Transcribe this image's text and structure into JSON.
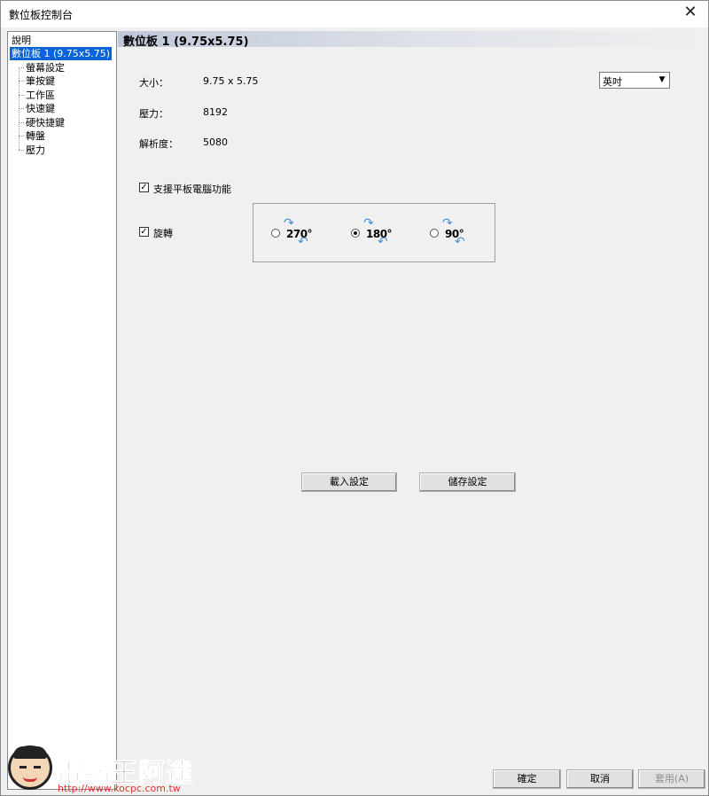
{
  "window": {
    "title": "數位板控制台",
    "close_glyph": "✕"
  },
  "tree": {
    "root": "說明",
    "selected": "數位板  1 (9.75x5.75)",
    "children": [
      "螢幕設定",
      "筆按鍵",
      "工作區",
      "快速鍵",
      "硬快捷鍵",
      "轉盤",
      "壓力"
    ]
  },
  "panel": {
    "header": "數位板  1 (9.75x5.75)",
    "size_label": "大小：",
    "size_value": "9.75 x 5.75",
    "pressure_label": "壓力：",
    "pressure_value": "8192",
    "resolution_label": "解析度：",
    "resolution_value": "5080",
    "unit_select": {
      "value": "英吋",
      "arrow": "▼"
    },
    "tablet_pc": {
      "label": "支援平板電腦功能",
      "checked": true,
      "mark": "✓"
    },
    "rotate": {
      "label": "旋轉",
      "checked": true,
      "mark": "✓",
      "options": [
        {
          "value": "270°",
          "selected": false
        },
        {
          "value": "180°",
          "selected": true
        },
        {
          "value": "90°",
          "selected": false
        }
      ],
      "arrow_icon_top": "↷",
      "arrow_icon_bottom": "↶"
    },
    "load_button": "載入設定",
    "save_button": "儲存設定"
  },
  "footer": {
    "ok": "確定",
    "cancel": "取消",
    "apply": "套用(A)"
  },
  "watermark": {
    "name": "電腦王阿達",
    "url": "http://www.kocpc.com.tw"
  },
  "colors": {
    "selection": "#0a64d8",
    "arrow": "#4a8fd6",
    "header_gradient": "#c0c8d8"
  }
}
